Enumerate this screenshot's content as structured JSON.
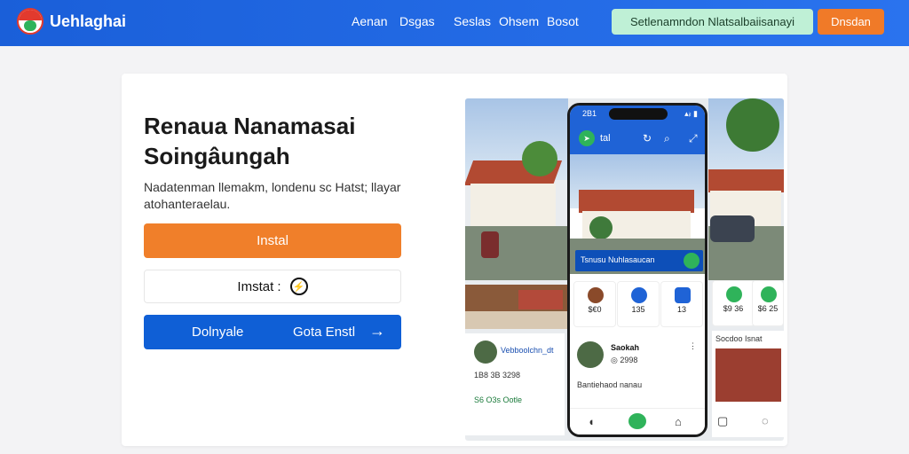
{
  "header": {
    "brand": "Uehlaghai",
    "nav": [
      "Aenan",
      "Dsgas",
      "Seslas",
      "Ohsem",
      "Bosot"
    ],
    "cta_secondary": "Setlenamndon Nlatsalbaiisanayi",
    "cta_primary": "Dnsdan"
  },
  "hero": {
    "headline_line1": "Renaua Nanamasai",
    "headline_line2": "Soingâungah",
    "description": "Nadatenman llemakm, londenu sc Hatst; llayar atohanteraelau.",
    "install_label": "Instal",
    "instant_label": "Imstat :",
    "blue_left": "Dolnyale",
    "blue_right": "Gota Enstl",
    "blue_arrow": "→"
  },
  "phone": {
    "time": "2B1",
    "signal": "▴ᵢₗ ▮",
    "title": "tal",
    "caption": "Tsnusu Nuhlasaucan",
    "tiles": [
      "$€0",
      "135",
      "13",
      "$9 36",
      "$6 25"
    ],
    "post_name": "Saokah",
    "post_meta": "◎ 2998",
    "post_body": "Bantiehaod nanau",
    "left_name": "Vebboolchn_dt",
    "left_meta": "1B8 3B 3298",
    "left_tag": "S6 O3s Ootle",
    "right_title": "Socdoo Isnat"
  },
  "colors": {
    "topbar": "#1a5fd9",
    "orange": "#f07f2a",
    "blue": "#0f5fd6",
    "green": "#2fb35a"
  }
}
